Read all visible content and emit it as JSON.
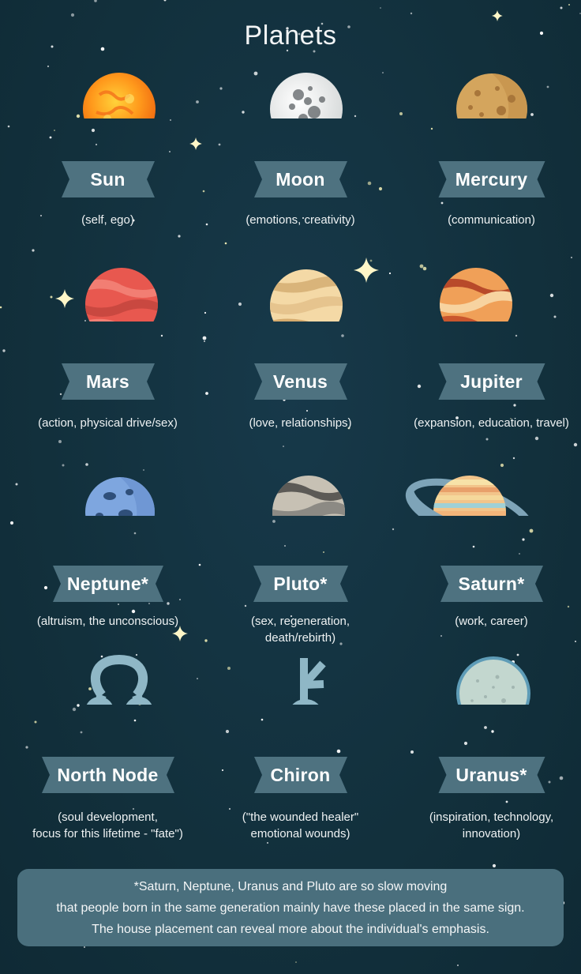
{
  "title": "Planets",
  "colors": {
    "background": "#13303d",
    "ribbon": "#4e7280",
    "note_box": "#4a6f7d",
    "text": "#ffffff"
  },
  "planets": [
    {
      "name": "Sun",
      "description": "(self, ego)",
      "icon": "sun-icon"
    },
    {
      "name": "Moon",
      "description": "(emotions, creativity)",
      "icon": "moon-icon"
    },
    {
      "name": "Mercury",
      "description": "(communication)",
      "icon": "mercury-icon"
    },
    {
      "name": "Mars",
      "description": "(action, physical drive/sex)",
      "icon": "mars-icon"
    },
    {
      "name": "Venus",
      "description": "(love, relationships)",
      "icon": "venus-icon"
    },
    {
      "name": "Jupiter",
      "description": "(expansion, education, travel)",
      "icon": "jupiter-icon"
    },
    {
      "name": "Neptune*",
      "description": "(altruism, the unconscious)",
      "icon": "neptune-icon"
    },
    {
      "name": "Pluto*",
      "description": "(sex, regeneration,\ndeath/rebirth)",
      "icon": "pluto-icon"
    },
    {
      "name": "Saturn*",
      "description": "(work, career)",
      "icon": "saturn-icon"
    },
    {
      "name": "North Node",
      "description": "(soul development,\nfocus for this lifetime - \"fate\")",
      "icon": "north-node-symbol-icon"
    },
    {
      "name": "Chiron",
      "description": "(\"the wounded healer\"\nemotional wounds)",
      "icon": "chiron-symbol-icon"
    },
    {
      "name": "Uranus*",
      "description": "(inspiration, technology,\ninnovation)",
      "icon": "uranus-icon"
    }
  ],
  "footnote": {
    "line1": "*Saturn, Neptune, Uranus and Pluto are so slow moving",
    "line2": "that people born in the same generation  mainly have these placed in the same sign.",
    "line3": "The house placement can reveal more about  the individual's emphasis."
  }
}
